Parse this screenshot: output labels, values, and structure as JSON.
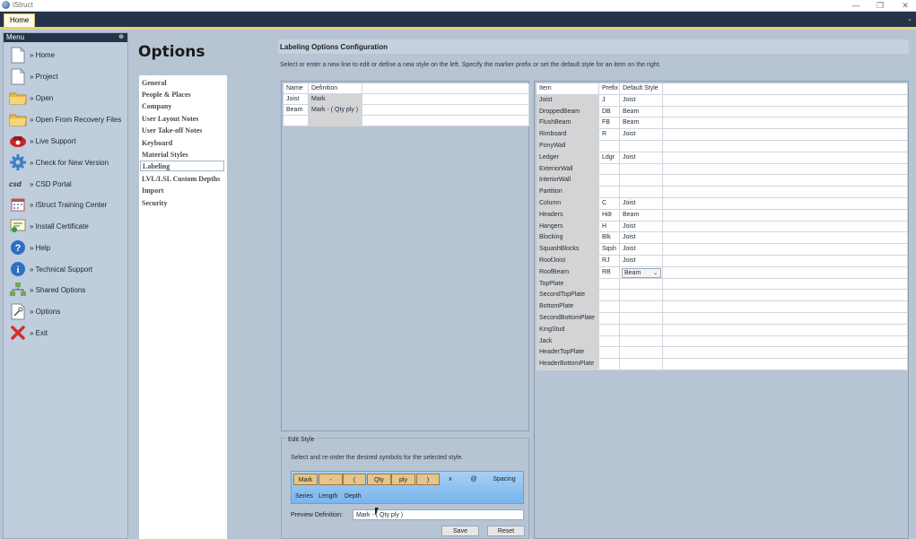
{
  "window": {
    "title": "iStruct",
    "buttons": {
      "minimize": "—",
      "restore": "❐",
      "close": "✕"
    }
  },
  "ribbon": {
    "tab_home": "Home",
    "collapse_glyph": "⌄"
  },
  "menu": {
    "header": "Menu",
    "pin_glyph": "⊕",
    "items": [
      {
        "label": "» Home",
        "icon": "document-icon"
      },
      {
        "label": "» Project",
        "icon": "document-icon"
      },
      {
        "label": "» Open",
        "icon": "folder-icon"
      },
      {
        "label": "» Open From Recovery Files",
        "icon": "folder-icon"
      },
      {
        "label": "» Live Support",
        "icon": "phone-icon"
      },
      {
        "label": "» Check for New Version",
        "icon": "gear-icon"
      },
      {
        "label": "» CSD Portal",
        "icon": "csd-logo-icon"
      },
      {
        "label": "» iStruct Training Center",
        "icon": "calendar-icon"
      },
      {
        "label": "» Install Certificate",
        "icon": "certificate-icon"
      },
      {
        "label": "» Help",
        "icon": "help-icon"
      },
      {
        "label": "» Technical Support",
        "icon": "info-icon"
      },
      {
        "label": "» Shared Options",
        "icon": "network-icon"
      },
      {
        "label": "» Options",
        "icon": "options-icon"
      },
      {
        "label": "» Exit",
        "icon": "exit-icon"
      }
    ]
  },
  "options": {
    "title": "Options",
    "nav": [
      "General",
      "People & Places",
      "Company",
      "User Layout Notes",
      "User Take-off Notes",
      "Keyboard",
      "Material Styles",
      "Labeling",
      "LVL/LSL Custom Depths",
      "Import",
      "Security"
    ],
    "selected_nav": "Labeling"
  },
  "config": {
    "title": "Labeling Options Configuration",
    "help": "Select or enter a new line to edit or define a new style on the left. Specify the marker prefix or set the default style for an item on the right."
  },
  "style_table": {
    "headers": [
      "Name",
      "Definition"
    ],
    "rows": [
      {
        "name": "Joist",
        "definition": "Mark"
      },
      {
        "name": "Beam",
        "definition": "Mark - ( Qty ply )"
      },
      {
        "name": "",
        "definition": ""
      }
    ]
  },
  "item_table": {
    "headers": [
      "Item",
      "Prefix",
      "Default Style"
    ],
    "rows": [
      {
        "item": "Joist",
        "prefix": "J",
        "style": "Joist"
      },
      {
        "item": "DroppedBeam",
        "prefix": "DB",
        "style": "Beam"
      },
      {
        "item": "FlushBeam",
        "prefix": "FB",
        "style": "Beam"
      },
      {
        "item": "Rimboard",
        "prefix": "R",
        "style": "Joist"
      },
      {
        "item": "PonyWall",
        "prefix": "",
        "style": ""
      },
      {
        "item": "Ledger",
        "prefix": "Ldgr",
        "style": "Joist"
      },
      {
        "item": "ExteriorWall",
        "prefix": "",
        "style": ""
      },
      {
        "item": "InteriorWall",
        "prefix": "",
        "style": ""
      },
      {
        "item": "Partition",
        "prefix": "",
        "style": ""
      },
      {
        "item": "Column",
        "prefix": "C",
        "style": "Joist"
      },
      {
        "item": "Headers",
        "prefix": "Hdr",
        "style": "Beam"
      },
      {
        "item": "Hangers",
        "prefix": "H",
        "style": "Joist"
      },
      {
        "item": "Blocking",
        "prefix": "Blk",
        "style": "Joist"
      },
      {
        "item": "SquashBlocks",
        "prefix": "Sqsh",
        "style": "Joist"
      },
      {
        "item": "RoofJoist",
        "prefix": "RJ",
        "style": "Joist"
      },
      {
        "item": "RoofBeam",
        "prefix": "RB",
        "style": "Beam",
        "combo": true
      },
      {
        "item": "TopPlate",
        "prefix": "",
        "style": ""
      },
      {
        "item": "SecondTopPlate",
        "prefix": "",
        "style": ""
      },
      {
        "item": "BottomPlate",
        "prefix": "",
        "style": ""
      },
      {
        "item": "SecondBottomPlate",
        "prefix": "",
        "style": ""
      },
      {
        "item": "KingStud",
        "prefix": "",
        "style": ""
      },
      {
        "item": "Jack",
        "prefix": "",
        "style": ""
      },
      {
        "item": "HeaderTopPlate",
        "prefix": "",
        "style": ""
      },
      {
        "item": "HeaderBottomPlate",
        "prefix": "",
        "style": ""
      }
    ]
  },
  "edit_style": {
    "legend": "Edit Style",
    "help": "Select and re-order the desired symbols for the selected style.",
    "symbols_row1": [
      "Mark",
      "-",
      "(",
      "Qty",
      "ply",
      ")",
      "x",
      "@",
      "Spacing"
    ],
    "symbols_row2": [
      "Series",
      "Length",
      "Depth"
    ],
    "preview_label": "Preview Definition:",
    "preview_value": "Mark - ( Qty ply )",
    "save": "Save",
    "reset": "Reset"
  },
  "colors": {
    "ribbon": "#25344a",
    "accent_gold": "#e8d27a",
    "panel": "#b7c4d4",
    "symbol_bar": "#79b5ec",
    "symbol_active": "#e5c58c"
  }
}
